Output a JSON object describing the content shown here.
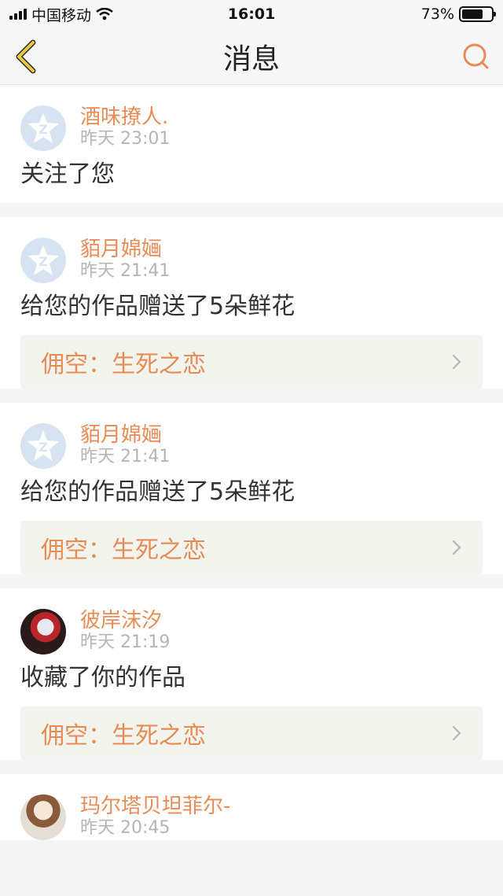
{
  "status": {
    "carrier": "中国移动",
    "time": "16:01",
    "battery": "73%",
    "battery_level": 0.73
  },
  "nav": {
    "title": "消息",
    "back_icon": "back-arrow-icon",
    "search_icon": "search-icon"
  },
  "colors": {
    "accent": "#e88c57",
    "back_icon": "#e6c93f",
    "card_link_bg": "#f4f4ef"
  },
  "messages": [
    {
      "name": "酒味撩人.",
      "time": "昨天 23:01",
      "content": "关注了您",
      "avatar": "default-avatar-icon"
    },
    {
      "name": "貊月婂婳",
      "time": "昨天 21:41",
      "content": "给您的作品赠送了5朵鲜花",
      "work": "佣空：生死之恋",
      "avatar": "default-avatar-icon"
    },
    {
      "name": "貊月婂婳",
      "time": "昨天 21:41",
      "content": "给您的作品赠送了5朵鲜花",
      "work": "佣空：生死之恋",
      "avatar": "default-avatar-icon"
    },
    {
      "name": "彼岸沫汐",
      "time": "昨天 21:19",
      "content": "收藏了你的作品",
      "work": "佣空：生死之恋",
      "avatar": "user-photo"
    },
    {
      "name": "玛尔塔贝坦菲尔-",
      "time": "昨天 20:45",
      "avatar": "user-photo"
    }
  ]
}
